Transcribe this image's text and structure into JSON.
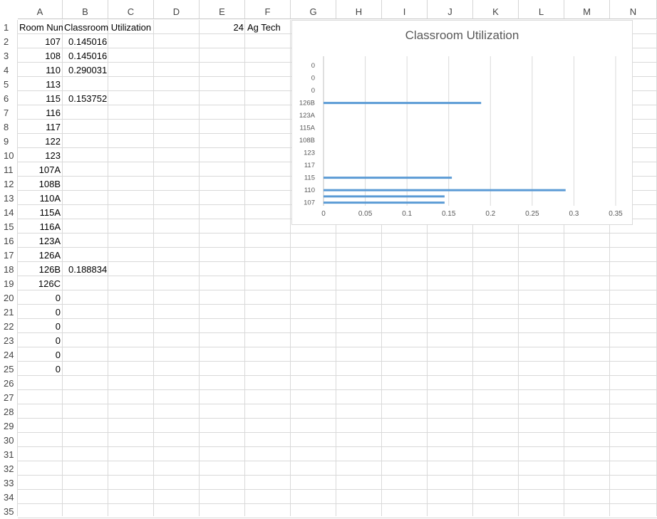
{
  "columns": [
    "A",
    "B",
    "C",
    "D",
    "E",
    "F",
    "G",
    "H",
    "I",
    "J",
    "K",
    "L",
    "M",
    "N"
  ],
  "rows": [
    "1",
    "2",
    "3",
    "4",
    "5",
    "6",
    "7",
    "8",
    "9",
    "10",
    "11",
    "12",
    "13",
    "14",
    "15",
    "16",
    "17",
    "18",
    "19",
    "20",
    "21",
    "22",
    "23",
    "24",
    "25",
    "26",
    "27",
    "28",
    "29",
    "30",
    "31",
    "32",
    "33",
    "34",
    "35"
  ],
  "cells": {
    "A1": "Room Number",
    "B1": "Classroom Utilization",
    "E1": "24",
    "F1": "Ag Tech",
    "room_numbers": [
      "107",
      "108",
      "110",
      "113",
      "115",
      "116",
      "117",
      "122",
      "123",
      "107A",
      "108B",
      "110A",
      "115A",
      "116A",
      "123A",
      "126A",
      "126B",
      "126C",
      "0",
      "0",
      "0",
      "0",
      "0",
      "0"
    ],
    "utilization": [
      "0.145016",
      "0.145016",
      "0.290031",
      "",
      "0.153752",
      "",
      "",
      "",
      "",
      "",
      "",
      "",
      "",
      "",
      "",
      "",
      "0.188834",
      "",
      "",
      "",
      "",
      "",
      "",
      ""
    ]
  },
  "chart_data": {
    "type": "bar",
    "orientation": "horizontal",
    "title": "Classroom Utilization",
    "category_labels": [
      "107",
      "110",
      "115",
      "117",
      "123",
      "108B",
      "115A",
      "123A",
      "126B",
      "0",
      "0",
      "0"
    ],
    "categories": [
      "107",
      "108",
      "110",
      "113",
      "115",
      "116",
      "117",
      "122",
      "123",
      "107A",
      "108B",
      "110A",
      "115A",
      "116A",
      "123A",
      "126A",
      "126B",
      "126C",
      "0",
      "0",
      "0",
      "0",
      "0",
      "0"
    ],
    "values": [
      0.145016,
      0.145016,
      0.290031,
      0,
      0.153752,
      0,
      0,
      0,
      0,
      0,
      0,
      0,
      0,
      0,
      0,
      0,
      0.188834,
      0,
      0,
      0,
      0,
      0,
      0,
      0
    ],
    "xlim": [
      0,
      0.35
    ],
    "x_ticks": [
      "0",
      "0.05",
      "0.1",
      "0.15",
      "0.2",
      "0.25",
      "0.3",
      "0.35"
    ],
    "grid": true,
    "bar_color": "#5b9bd5"
  }
}
